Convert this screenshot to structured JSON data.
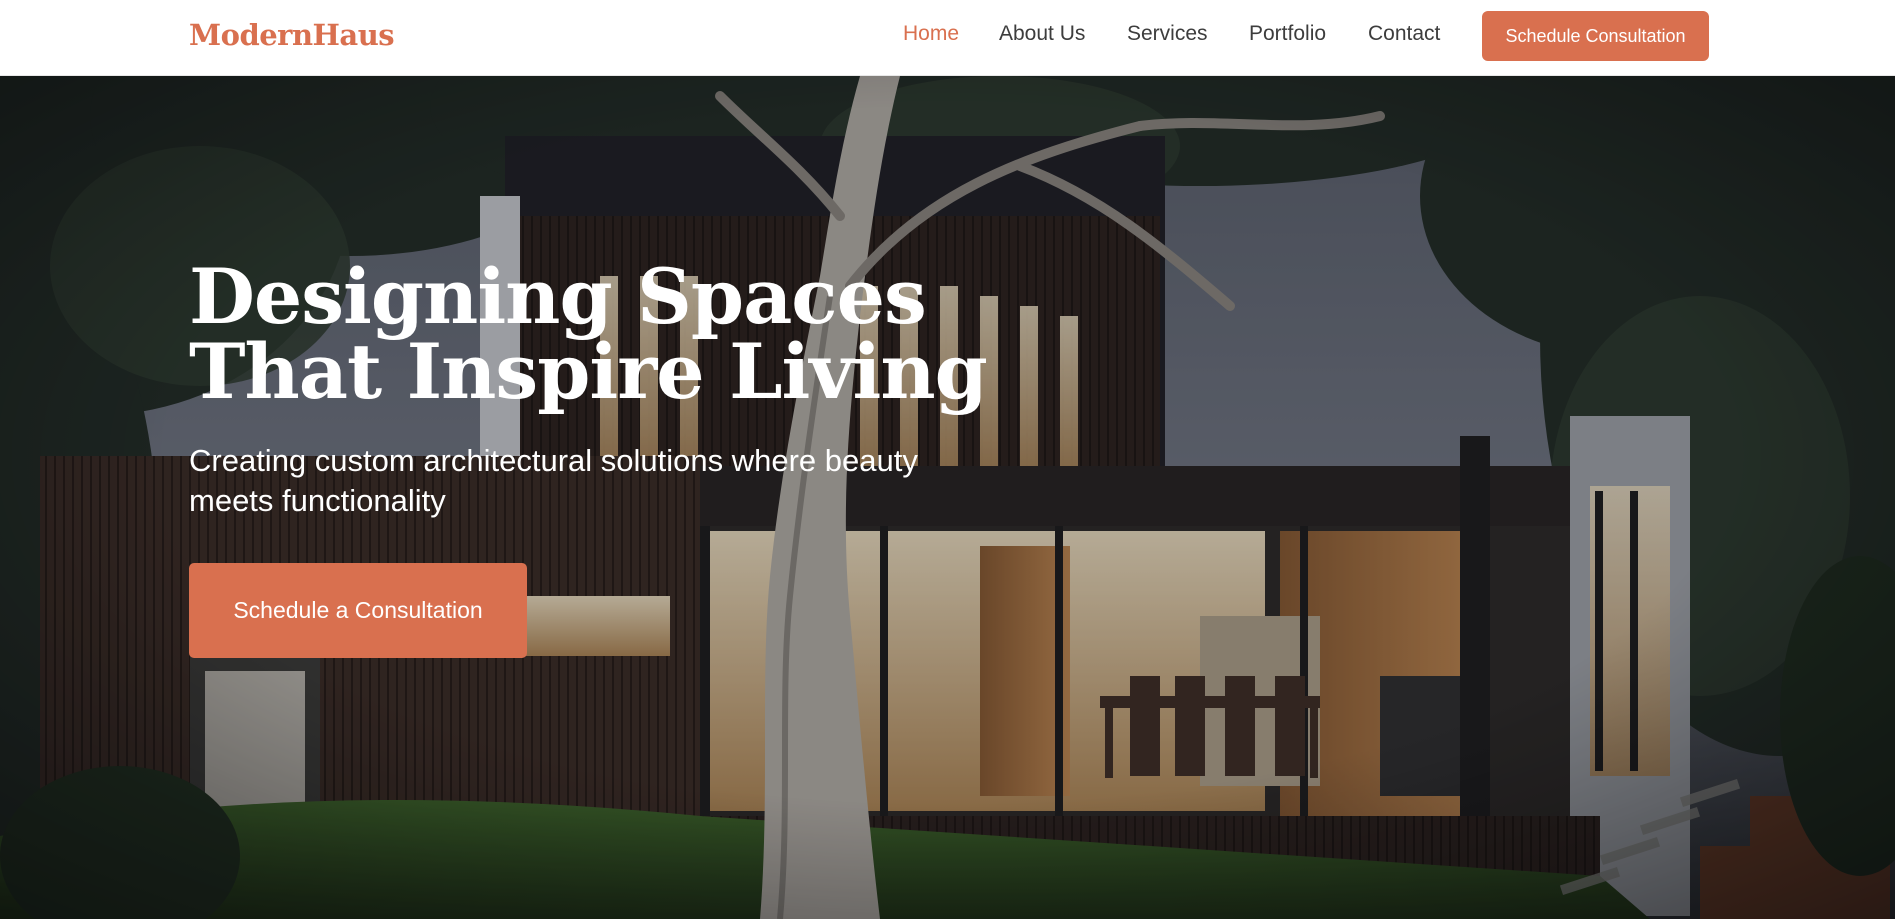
{
  "brand": {
    "name": "ModernHaus",
    "accent": "#d9704f"
  },
  "nav": {
    "links": [
      {
        "label": "Home",
        "active": true
      },
      {
        "label": "About Us",
        "active": false
      },
      {
        "label": "Services",
        "active": false
      },
      {
        "label": "Portfolio",
        "active": false
      },
      {
        "label": "Contact",
        "active": false
      }
    ],
    "cta_label": "Schedule Consultation"
  },
  "hero": {
    "title_line1": "Designing Spaces",
    "title_line2": "That Inspire Living",
    "subtitle": "Creating custom architectural solutions where beauty meets functionality",
    "cta_label": "Schedule a Consultation",
    "image": "modern-house-exterior-at-dusk"
  },
  "colors": {
    "nav_bg": "#ffffff",
    "nav_text": "#3d3d3d",
    "hero_text": "#ffffff",
    "accent": "#d9704f"
  }
}
